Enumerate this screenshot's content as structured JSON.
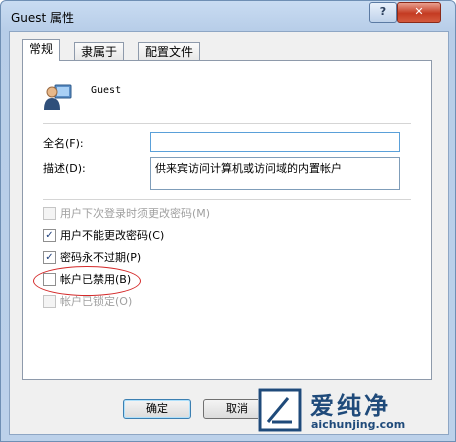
{
  "window": {
    "title": "Guest 属性",
    "help_label": "?",
    "close_label": "✕"
  },
  "tabs": [
    {
      "label": "常规",
      "active": true
    },
    {
      "label": "隶属于",
      "active": false
    },
    {
      "label": "配置文件",
      "active": false
    }
  ],
  "general": {
    "username": "Guest",
    "fullname_label": "全名(F):",
    "fullname_value": "",
    "description_label": "描述(D):",
    "description_value": "供来宾访问计算机或访问域的内置帐户",
    "options": [
      {
        "label": "用户下次登录时须更改密码(M)",
        "checked": false,
        "enabled": false
      },
      {
        "label": "用户不能更改密码(C)",
        "checked": true,
        "enabled": true
      },
      {
        "label": "密码永不过期(P)",
        "checked": true,
        "enabled": true
      },
      {
        "label": "帐户已禁用(B)",
        "checked": false,
        "enabled": true
      },
      {
        "label": "帐户已锁定(O)",
        "checked": false,
        "enabled": false
      }
    ],
    "highlight_color": "#d42a2a"
  },
  "buttons": {
    "ok": "确定",
    "cancel": "取消"
  },
  "watermark": {
    "brand": "爱纯净",
    "url": "aichunjing.com"
  }
}
